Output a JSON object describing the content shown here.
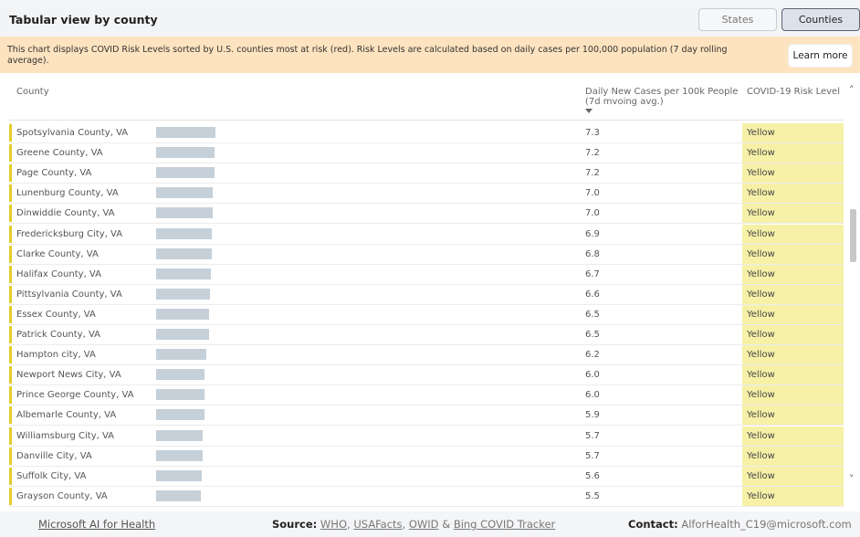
{
  "header": {
    "title": "Tabular view by county",
    "toggle_states": "States",
    "toggle_counties": "Counties"
  },
  "banner": {
    "text": "This chart displays COVID Risk Levels sorted by U.S. counties most at risk (red). Risk Levels are calculated based on daily cases per 100,000 population (7 day rolling average).",
    "learn_more": "Learn more"
  },
  "table": {
    "col_county": "County",
    "col_cases": "Daily New Cases per 100k People (7d mvoing avg.)",
    "col_risk": "COVID-19 Risk Level",
    "rows": [
      {
        "county": "Spotsylvania County, VA",
        "cases": "7.3",
        "risk": "Yellow"
      },
      {
        "county": "Greene County, VA",
        "cases": "7.2",
        "risk": "Yellow"
      },
      {
        "county": "Page County, VA",
        "cases": "7.2",
        "risk": "Yellow"
      },
      {
        "county": "Lunenburg County, VA",
        "cases": "7.0",
        "risk": "Yellow"
      },
      {
        "county": "Dinwiddie County, VA",
        "cases": "7.0",
        "risk": "Yellow"
      },
      {
        "county": "Fredericksburg City, VA",
        "cases": "6.9",
        "risk": "Yellow"
      },
      {
        "county": "Clarke County, VA",
        "cases": "6.8",
        "risk": "Yellow"
      },
      {
        "county": "Halifax County, VA",
        "cases": "6.7",
        "risk": "Yellow"
      },
      {
        "county": "Pittsylvania County, VA",
        "cases": "6.6",
        "risk": "Yellow"
      },
      {
        "county": "Essex County, VA",
        "cases": "6.5",
        "risk": "Yellow"
      },
      {
        "county": "Patrick County, VA",
        "cases": "6.5",
        "risk": "Yellow"
      },
      {
        "county": "Hampton city, VA",
        "cases": "6.2",
        "risk": "Yellow"
      },
      {
        "county": "Newport News City, VA",
        "cases": "6.0",
        "risk": "Yellow"
      },
      {
        "county": "Prince George County, VA",
        "cases": "6.0",
        "risk": "Yellow"
      },
      {
        "county": "Albemarle County, VA",
        "cases": "5.9",
        "risk": "Yellow"
      },
      {
        "county": "Williamsburg City, VA",
        "cases": "5.7",
        "risk": "Yellow"
      },
      {
        "county": "Danville City, VA",
        "cases": "5.7",
        "risk": "Yellow"
      },
      {
        "county": "Suffolk City, VA",
        "cases": "5.6",
        "risk": "Yellow"
      },
      {
        "county": "Grayson County, VA",
        "cases": "5.5",
        "risk": "Yellow"
      }
    ]
  },
  "footer": {
    "ms_link": "Microsoft AI for Health",
    "source_label": "Source:",
    "source_who": "WHO",
    "source_usafacts": "USAFacts",
    "source_owid": "OWID",
    "source_and": "&",
    "source_bing": "Bing COVID Tracker",
    "contact_label": "Contact:",
    "contact_email": "AlforHealth_C19@microsoft.com"
  },
  "colors": {
    "yellow_risk": "#f7f1a8",
    "stripe": "#e3cd2a",
    "bar": "#c6d0d9",
    "banner": "#fde3bf"
  },
  "icons": {
    "sort": "sort-descending-icon",
    "scroll_up": "chevron-up-icon",
    "scroll_down": "chevron-down-icon"
  }
}
